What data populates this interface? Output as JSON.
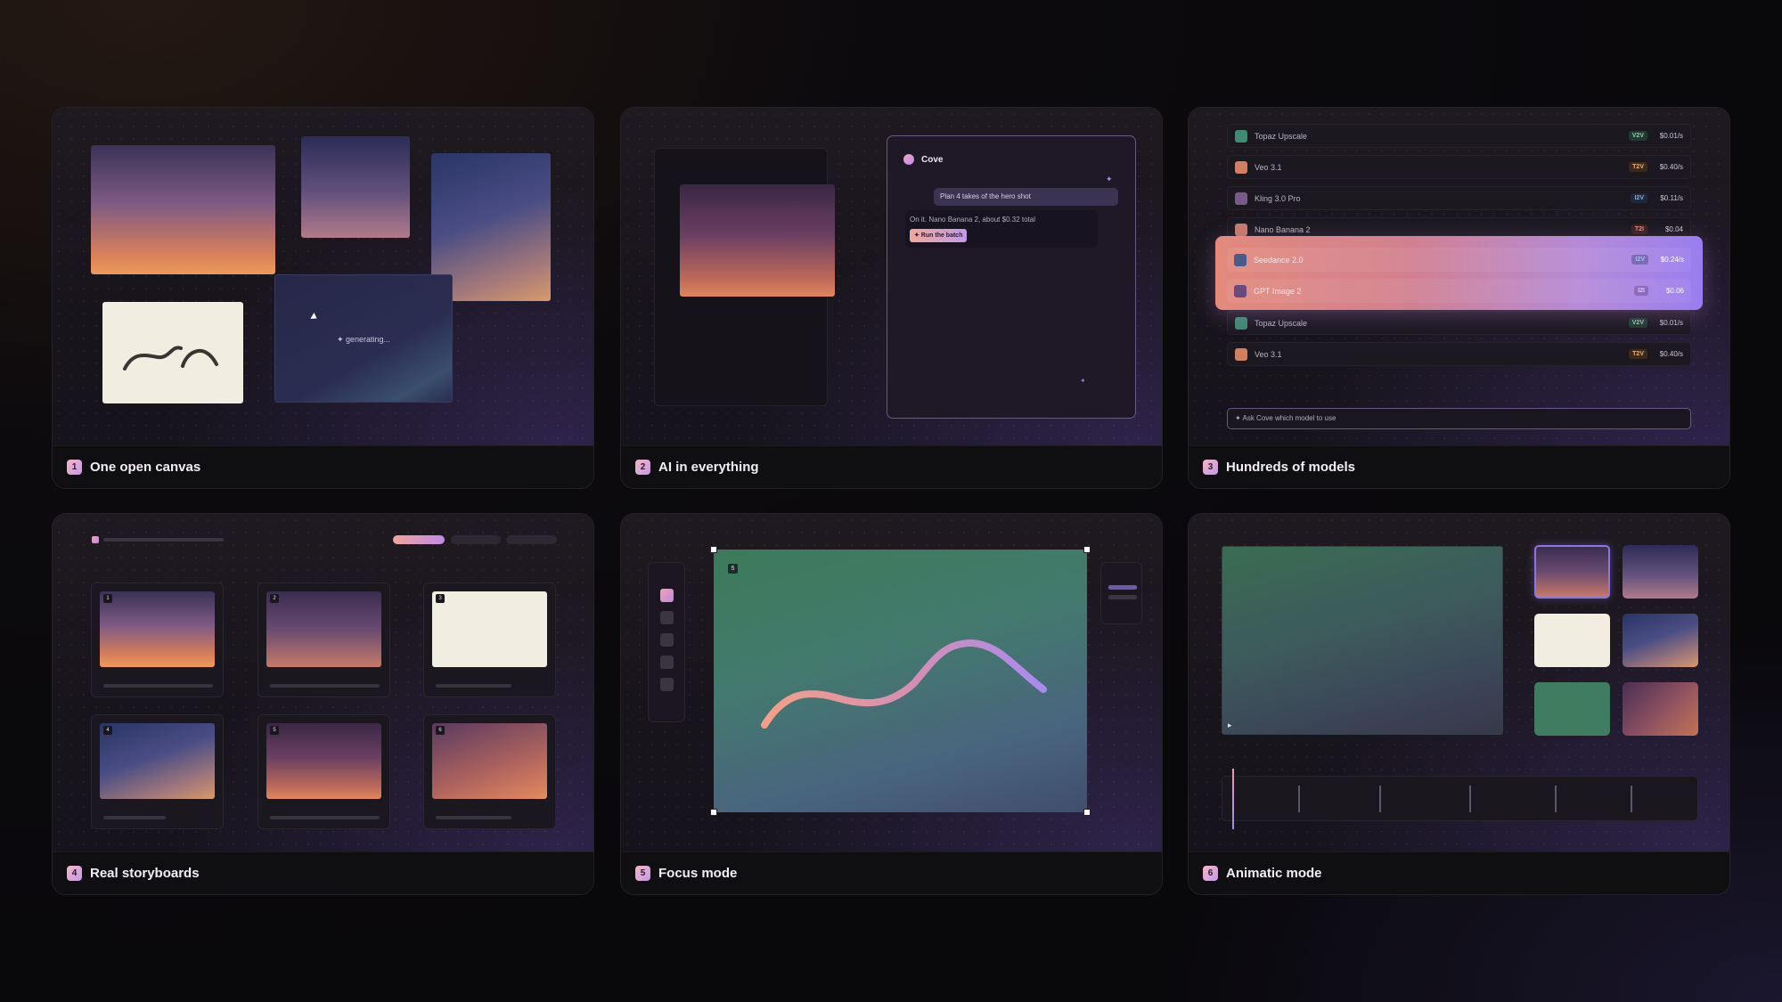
{
  "cards": [
    {
      "num": "1",
      "title": "One open canvas"
    },
    {
      "num": "2",
      "title": "AI in everything"
    },
    {
      "num": "3",
      "title": "Hundreds of models"
    },
    {
      "num": "4",
      "title": "Real storyboards"
    },
    {
      "num": "5",
      "title": "Focus mode"
    },
    {
      "num": "6",
      "title": "Animatic mode"
    }
  ],
  "canvas": {
    "generating": "✦ generating..."
  },
  "chat": {
    "name": "Cove",
    "user_msg": "Plan 4 takes of the hero shot",
    "reply": "On it. Nano Banana 2, about $0.32 total",
    "run_button": "✦ Run the batch"
  },
  "models": {
    "rows": [
      {
        "name": "Topaz Upscale",
        "tag": "V2V",
        "price": "$0.01/s",
        "color": "#3f8a72",
        "tagColor": "#7fd3a8"
      },
      {
        "name": "Veo 3.1",
        "tag": "T2V",
        "price": "$0.40/s",
        "color": "#d08060",
        "tagColor": "#f0b070"
      },
      {
        "name": "Kling 3.0 Pro",
        "tag": "I2V",
        "price": "$0.11/s",
        "color": "#7a5a8a",
        "tagColor": "#8aa8f0"
      },
      {
        "name": "Nano Banana 2",
        "tag": "T2I",
        "price": "$0.04",
        "color": "#c57a6a",
        "tagColor": "#e8907a"
      },
      {
        "name": "Seedance 2.0",
        "tag": "I2V",
        "price": "$0.24/s",
        "color": "#4a5a8a",
        "tagColor": "#8aa8f0"
      },
      {
        "name": "GPT Image 2",
        "tag": "I2I",
        "price": "$0.06",
        "color": "#6a4a80",
        "tagColor": "#c0a0f0"
      },
      {
        "name": "Topaz Upscale",
        "tag": "V2V",
        "price": "$0.01/s",
        "color": "#3f8a72",
        "tagColor": "#7fd3a8"
      },
      {
        "name": "Veo 3.1",
        "tag": "T2V",
        "price": "$0.40/s",
        "color": "#d08060",
        "tagColor": "#f0b070"
      }
    ],
    "ask_placeholder": "✦ Ask Cove which model to use"
  },
  "storyboard": {
    "frames": [
      "1",
      "2",
      "3",
      "4",
      "5",
      "6"
    ]
  },
  "focus": {
    "frame_badge": "5"
  },
  "animatic": {
    "play": "▸"
  }
}
